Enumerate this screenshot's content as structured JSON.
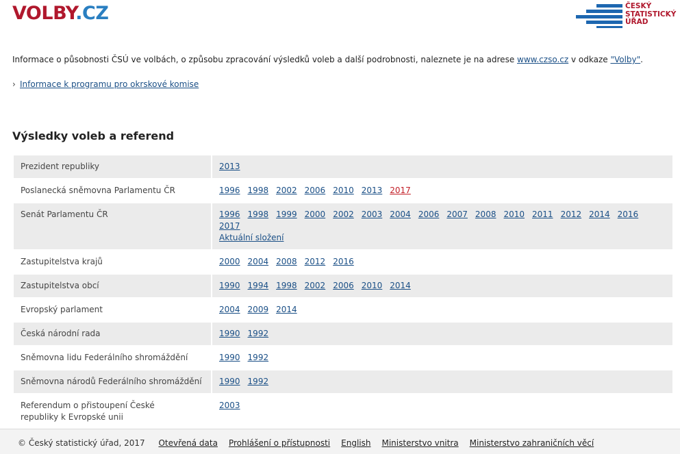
{
  "brand": {
    "part1": "VOLBY",
    "part2": ".CZ"
  },
  "csu_logo": {
    "line1": "ČESKÝ",
    "line2": "STATISTICKÝ",
    "line3": "ÚŘAD",
    "color_text": "#b0182d",
    "color_bars": "#1d67b0"
  },
  "intro": {
    "text_before": "Informace o působnosti ČSÚ ve volbách, o způsobu zpracování výsledků voleb a další podrobnosti, naleznete je na adrese ",
    "link1": "www.czso.cz",
    "text_middle": " v odkaze ",
    "link2": "\"Volby\"",
    "text_after": "."
  },
  "program_link": {
    "chevron": "›",
    "label": "Informace k programu pro okrskové komise"
  },
  "section_title": "Výsledky voleb a referend",
  "rows": [
    {
      "label": "Prezident republiky",
      "years": [
        "2013"
      ]
    },
    {
      "label": "Poslanecká sněmovna Parlamentu ČR",
      "years": [
        "1996",
        "1998",
        "2002",
        "2006",
        "2010",
        "2013",
        "2017"
      ],
      "highlight": "2017"
    },
    {
      "label": "Senát Parlamentu ČR",
      "years": [
        "1996",
        "1998",
        "1999",
        "2000",
        "2002",
        "2003",
        "2004",
        "2006",
        "2007",
        "2008",
        "2010",
        "2011",
        "2012",
        "2014",
        "2016",
        "2017"
      ],
      "extra": "Aktuální složení"
    },
    {
      "label": "Zastupitelstva krajů",
      "years": [
        "2000",
        "2004",
        "2008",
        "2012",
        "2016"
      ]
    },
    {
      "label": "Zastupitelstva obcí",
      "years": [
        "1990",
        "1994",
        "1998",
        "2002",
        "2006",
        "2010",
        "2014"
      ]
    },
    {
      "label": "Evropský parlament",
      "years": [
        "2004",
        "2009",
        "2014"
      ]
    },
    {
      "label": "Česká národní rada",
      "years": [
        "1990",
        "1992"
      ]
    },
    {
      "label": "Sněmovna lidu Federálního shromáždění",
      "years": [
        "1990",
        "1992"
      ]
    },
    {
      "label": "Sněmovna národů Federálního shromáždění",
      "years": [
        "1990",
        "1992"
      ]
    },
    {
      "label": "Referendum o přistoupení České republiky k Evropské unii",
      "years": [
        "2003"
      ]
    }
  ],
  "footer": {
    "copyright": "© Český statistický úřad, 2017",
    "links": [
      "Otevřená data",
      "Prohlášení o přístupnosti",
      "English",
      "Ministerstvo vnitra",
      "Ministerstvo zahraničních věcí"
    ]
  }
}
